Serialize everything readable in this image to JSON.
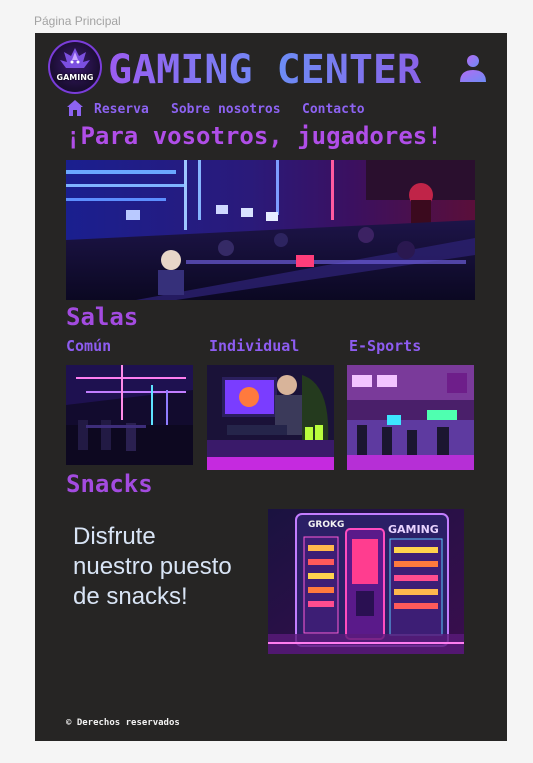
{
  "frame": {
    "label": "Página Principal"
  },
  "header": {
    "logo_text": "GAMING",
    "title": "GAMING CENTER",
    "user_icon": "user-icon"
  },
  "nav": {
    "home_icon": "home-icon",
    "items": [
      {
        "label": "Reserva"
      },
      {
        "label": "Sobre nosotros"
      },
      {
        "label": "Contacto"
      }
    ]
  },
  "hero": {
    "heading": "¡Para vosotros, jugadores!",
    "image": "gaming-room-photo"
  },
  "rooms": {
    "heading": "Salas",
    "items": [
      {
        "title": "Común",
        "image": "common-room-photo"
      },
      {
        "title": "Individual",
        "image": "individual-room-photo"
      },
      {
        "title": "E-Sports",
        "image": "esports-room-photo"
      }
    ]
  },
  "snacks": {
    "heading": "Snacks",
    "text": "Disfrute nuestro puesto de snacks!",
    "image": "snack-vending-machine-photo",
    "machine_brand": "GAMING",
    "machine_logo": "GROKG"
  },
  "footer": {
    "text": "© Derechos reservados"
  },
  "colors": {
    "background": "#262524",
    "accent_purple": "#a34be0",
    "accent_violet": "#8d63f2",
    "text_light": "#d8e4f5"
  }
}
